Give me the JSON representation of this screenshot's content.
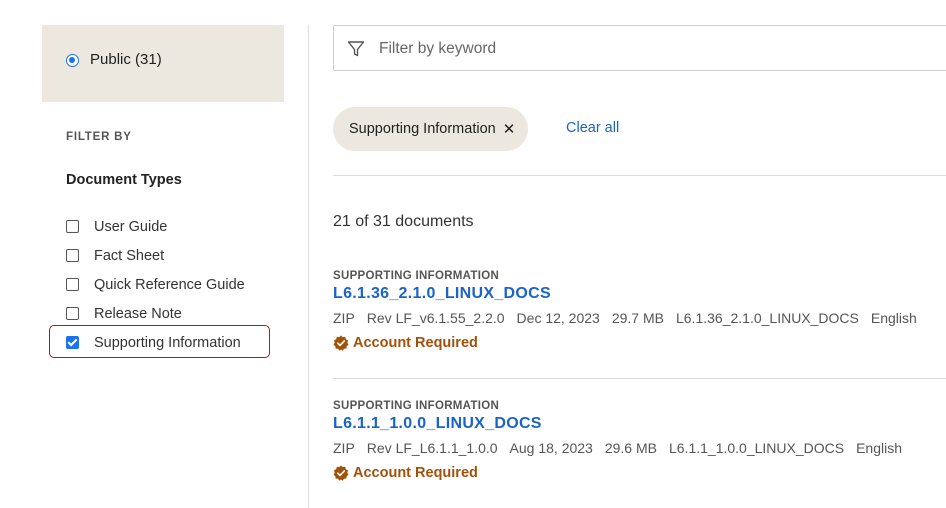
{
  "access": {
    "label": "Public (31)",
    "selected": true
  },
  "filters": {
    "heading": "FILTER BY",
    "group_title": "Document Types",
    "items": [
      {
        "label": "User Guide",
        "checked": false
      },
      {
        "label": "Fact Sheet",
        "checked": false
      },
      {
        "label": "Quick Reference Guide",
        "checked": false
      },
      {
        "label": "Release Note",
        "checked": false
      },
      {
        "label": "Supporting Information",
        "checked": true
      }
    ]
  },
  "search": {
    "placeholder": "Filter by keyword",
    "value": "",
    "icon": "filter-icon"
  },
  "active_filter": {
    "label": "Supporting Information",
    "remove": "✕"
  },
  "clear_all": "Clear all",
  "result_count": "21 of 31 documents",
  "documents": [
    {
      "category": "SUPPORTING INFORMATION",
      "title": "L6.1.36_2.1.0_LINUX_DOCS",
      "format": "ZIP",
      "rev": "Rev LF_v6.1.55_2.2.0",
      "date": "Dec 12, 2023",
      "size": "29.7 MB",
      "filename": "L6.1.36_2.1.0_LINUX_DOCS",
      "language": "English",
      "access": "Account Required"
    },
    {
      "category": "SUPPORTING INFORMATION",
      "title": "L6.1.1_1.0.0_LINUX_DOCS",
      "format": "ZIP",
      "rev": "Rev LF_L6.1.1_1.0.0",
      "date": "Aug 18, 2023",
      "size": "29.6 MB",
      "filename": "L6.1.1_1.0.0_LINUX_DOCS",
      "language": "English",
      "access": "Account Required"
    }
  ],
  "colors": {
    "accent": "#1a63c7",
    "panel": "#ece7df",
    "warning": "#a0520a",
    "highlight": "#d9001b"
  }
}
